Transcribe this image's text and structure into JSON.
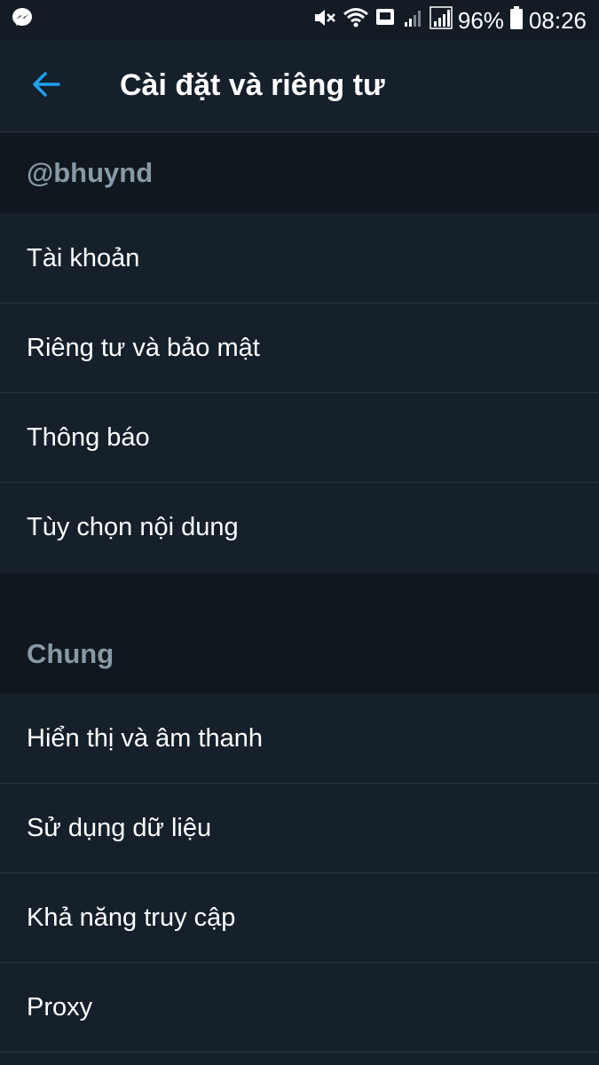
{
  "status_bar": {
    "battery_percent": "96%",
    "time": "08:26",
    "icons": [
      "messenger-icon",
      "mute-icon",
      "wifi-icon",
      "notification-icon",
      "signal-icon",
      "signal-icon",
      "battery-icon"
    ]
  },
  "header": {
    "title": "Cài đặt và riêng tư",
    "back_icon": "arrow-left-icon"
  },
  "sections": [
    {
      "header": "@bhuynd",
      "items": [
        "Tài khoản",
        "Riêng tư và bảo mật",
        "Thông báo",
        "Tùy chọn nội dung"
      ]
    },
    {
      "header": "Chung",
      "items": [
        "Hiển thị và âm thanh",
        "Sử dụng dữ liệu",
        "Khả năng truy cập",
        "Proxy"
      ]
    }
  ],
  "colors": {
    "background": "#15202b",
    "section_background": "#10171e",
    "accent": "#1da1f2",
    "muted_text": "#8899a6",
    "divider": "#2a3540"
  }
}
